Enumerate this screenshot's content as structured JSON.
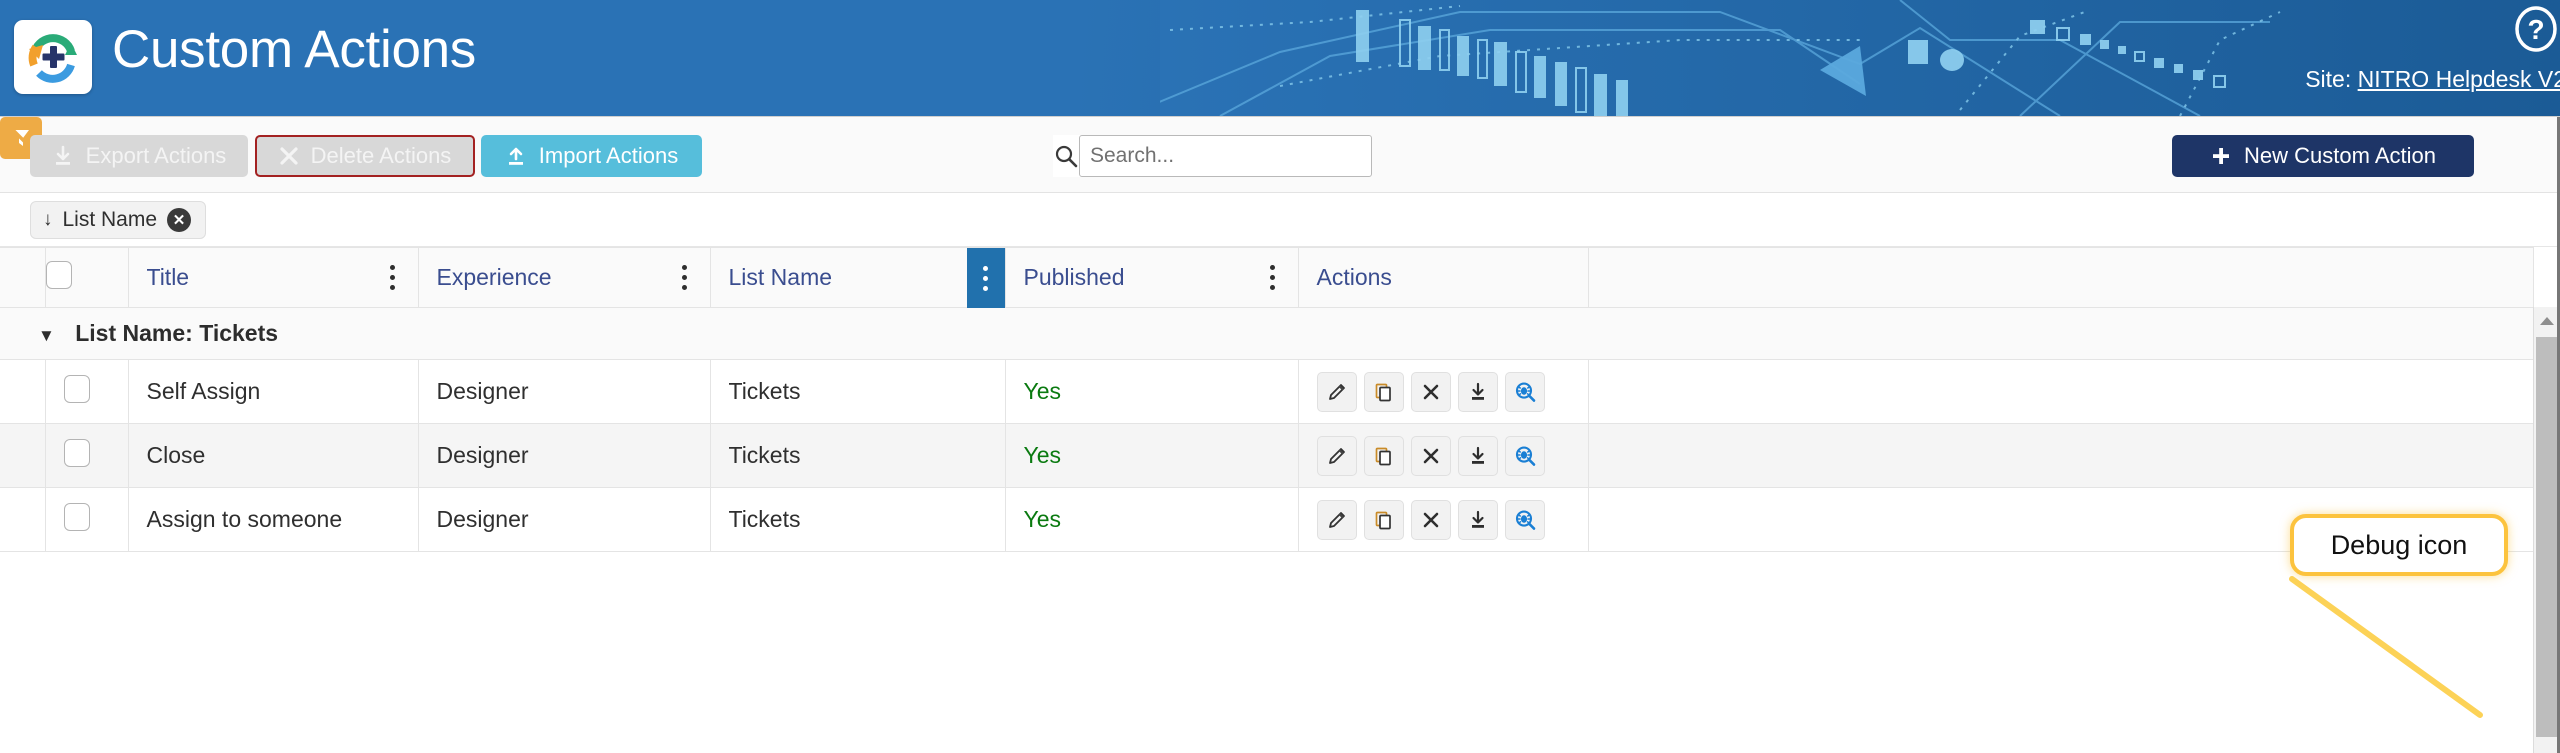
{
  "banner": {
    "title": "Custom Actions",
    "logo_icon": "nitro-refresh-plus-logo",
    "help_icon": "help-question-icon",
    "site_label": "Site:",
    "site_name": "NITRO Helpdesk V2"
  },
  "toolbar": {
    "export_label": "Export Actions",
    "export_icon": "download-icon",
    "delete_label": "Delete Actions",
    "delete_icon": "close-x-icon",
    "import_label": "Import Actions",
    "import_icon": "upload-icon",
    "clear_filter_icon": "filter-clear-icon",
    "search_icon": "search-icon",
    "search_value": "",
    "search_placeholder": "Search...",
    "new_label": "New Custom Action",
    "new_icon": "plus-icon"
  },
  "sort_chip": {
    "arrow_icon": "arrow-down-icon",
    "label": "List Name",
    "remove_icon": "circle-x-icon"
  },
  "table": {
    "columns": [
      {
        "label": "Title",
        "kebab_active": false
      },
      {
        "label": "Experience",
        "kebab_active": false
      },
      {
        "label": "List Name",
        "kebab_active": true
      },
      {
        "label": "Published",
        "kebab_active": false
      },
      {
        "label": "Actions",
        "kebab_active": false
      }
    ],
    "group": {
      "caret_icon": "caret-down-icon",
      "label": "List Name: Tickets"
    },
    "rows": [
      {
        "title": "Self Assign",
        "experience": "Designer",
        "list_name": "Tickets",
        "published": "Yes"
      },
      {
        "title": "Close",
        "experience": "Designer",
        "list_name": "Tickets",
        "published": "Yes"
      },
      {
        "title": "Assign to someone",
        "experience": "Designer",
        "list_name": "Tickets",
        "published": "Yes"
      }
    ],
    "row_actions": [
      {
        "name": "edit-icon"
      },
      {
        "name": "copy-icon"
      },
      {
        "name": "delete-icon"
      },
      {
        "name": "export-icon"
      },
      {
        "name": "debug-icon"
      }
    ]
  },
  "callout": {
    "text": "Debug icon",
    "border_color": "#fcc33e"
  },
  "colors": {
    "banner_blue": "#2a72b5",
    "primary_navy": "#1e3567",
    "import_teal": "#56bedb",
    "delete_red": "#a32121",
    "filter_orange": "#eeab45",
    "header_text_blue": "#3a4d8f",
    "published_green": "#0a7a10",
    "kebab_active_blue": "#2171ad"
  }
}
